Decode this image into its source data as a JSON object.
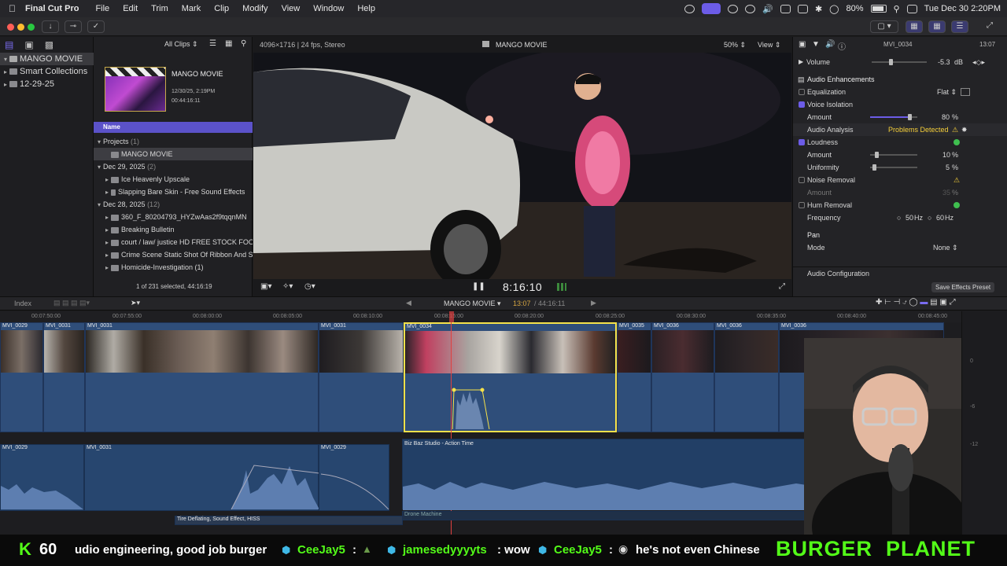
{
  "menubar": {
    "app": "Final Cut Pro",
    "items": [
      "File",
      "Edit",
      "Trim",
      "Mark",
      "Clip",
      "Modify",
      "View",
      "Window",
      "Help"
    ],
    "battery": "80%",
    "datetime": "Tue Dec 30  2:20PM"
  },
  "library": {
    "root": "MANGO MOVIE",
    "items": [
      "Smart Collections",
      "12-29-25"
    ]
  },
  "browser": {
    "filter": "All Clips",
    "project_name": "MANGO MOVIE",
    "project_date": "12/30/25, 2:19PM",
    "project_duration": "00:44:16:11",
    "col_name": "Name",
    "groups": [
      {
        "label": "Projects",
        "count": "(1)"
      },
      {
        "label": "Dec 29, 2025",
        "count": "(2)"
      },
      {
        "label": "Dec 28, 2025",
        "count": "(12)"
      }
    ],
    "project_item": "MANGO MOVIE",
    "dec29": [
      "Ice Heavenly Upscale",
      "Slapping Bare Skin - Free Sound Effects"
    ],
    "dec28": [
      "360_F_80204793_HYZwAas2f9tqqnMN",
      "Breaking Bulletin",
      "court / law/ justice HD FREE STOCK FOOT",
      "Crime Scene Static Shot Of Ribbon And S",
      "Homicide-Investigation (1)"
    ],
    "selected_status": "1 of 231 selected, 44:16:19"
  },
  "viewer": {
    "format": "4096×1716 | 24 fps, Stereo",
    "title": "MANGO MOVIE",
    "zoom": "50%",
    "view": "View",
    "timecode": "8:16:10"
  },
  "inspector": {
    "clip": "MVI_0034",
    "duration": "13:07",
    "volume_label": "Volume",
    "volume_value": "-5.3",
    "volume_unit": "dB",
    "enhancements": "Audio Enhancements",
    "equalization": "Equalization",
    "eq_value": "Flat",
    "voice_isolation": "Voice Isolation",
    "vi_amount_label": "Amount",
    "vi_amount": "80",
    "vi_amount_level": 0.8,
    "pct": "%",
    "audio_analysis": "Audio Analysis",
    "problems": "Problems Detected",
    "loudness": "Loudness",
    "loud_amount_label": "Amount",
    "loud_amount": "10",
    "loud_amount_level": 0.1,
    "uniformity_label": "Uniformity",
    "uniformity": "5",
    "uniformity_level": 0.05,
    "noise_removal": "Noise Removal",
    "nr_amount_label": "Amount",
    "nr_amount": "35",
    "hum_removal": "Hum Removal",
    "frequency_label": "Frequency",
    "freq_50": "50",
    "freq_60": "60",
    "hz": "Hz",
    "pan": "Pan",
    "mode_label": "Mode",
    "mode_value": "None",
    "audio_config": "Audio Configuration",
    "save_preset": "Save Effects Preset"
  },
  "timeline": {
    "index": "Index",
    "project": "MANGO MOVIE",
    "position": "13:07",
    "total": "/ 44:16:11",
    "ruler": [
      "00:07:50:00",
      "00:07:55:00",
      "00:08:00:00",
      "00:08:05:00",
      "00:08:10:00",
      "00:08:15:00",
      "00:08:20:00",
      "00:08:25:00",
      "00:08:30:00",
      "00:08:35:00",
      "00:08:40:00",
      "00:08:45:00"
    ],
    "clips": [
      "MVI_0029",
      "MVI_0031",
      "MVI_0031",
      "MVI_0031",
      "MVI_0034",
      "MVI_0035",
      "MVI_0036",
      "MVI_0036",
      "MVI_0036"
    ],
    "audio_clips": [
      "MVI_0029",
      "MVI_0031",
      "MVI_0029"
    ],
    "music": "Biz Baz Studio - Action Time",
    "sfx1": "Tire Deflating, Sound Effect, HISS",
    "sfx2": "Drone Machine",
    "meter_labels": [
      "0",
      "-6",
      "-12"
    ]
  },
  "chat": {
    "kick_count": "60",
    "message1": "udio engineering, good job burger",
    "user1": "CeeJay5",
    "colon": ":",
    "user2": "jamesedyyyyts",
    "msg2": ": wow",
    "user3": "CeeJay5",
    "msg3": "he's not even Chinese",
    "banner": "BURGER  PLANET"
  },
  "colors": {
    "accent": "#6c5ce7",
    "timeline_clip": "#2f4e7a",
    "selection": "#f5e14a",
    "chat_green": "#53fc18"
  }
}
